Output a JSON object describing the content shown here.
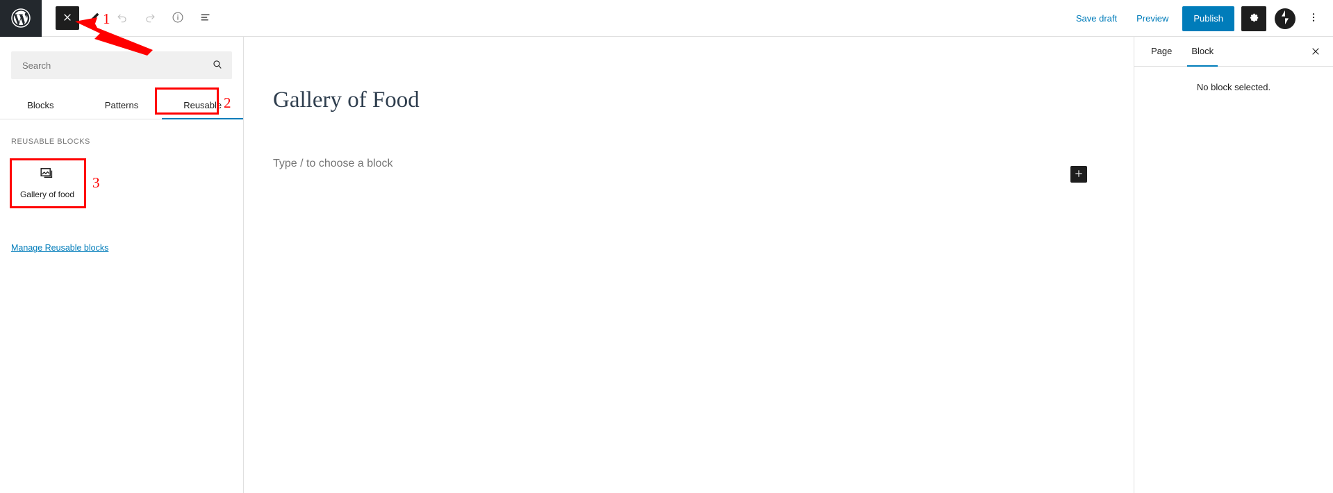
{
  "app": {
    "name": "WordPress Block Editor",
    "logo_icon": "wordpress-logo-icon"
  },
  "header": {
    "close_button": {
      "label": "Close",
      "icon": "close-icon"
    },
    "tools": [
      {
        "name": "edit-pencil",
        "icon": "pencil-icon",
        "label": "Edit",
        "disabled": false
      },
      {
        "name": "undo",
        "icon": "undo-arrow-icon",
        "label": "Undo",
        "disabled": true
      },
      {
        "name": "redo",
        "icon": "redo-arrow-icon",
        "label": "Redo",
        "disabled": true
      },
      {
        "name": "details",
        "icon": "info-circle-icon",
        "label": "Details",
        "disabled": false
      },
      {
        "name": "list-view",
        "icon": "list-view-icon",
        "label": "List view",
        "disabled": false
      }
    ],
    "save_draft_label": "Save draft",
    "preview_label": "Preview",
    "publish_label": "Publish",
    "settings_icon": "gear-icon",
    "jetpack_icon": "jetpack-icon",
    "more_options_icon": "kebab-menu-icon"
  },
  "inserter": {
    "search": {
      "placeholder": "Search",
      "value": "",
      "icon": "search-icon"
    },
    "tabs": [
      {
        "label": "Blocks",
        "active": false
      },
      {
        "label": "Patterns",
        "active": false
      },
      {
        "label": "Reusable",
        "active": true
      }
    ],
    "section_title": "REUSABLE BLOCKS",
    "blocks": [
      {
        "label": "Gallery of food",
        "icon": "gallery-icon"
      }
    ],
    "manage_link_label": "Manage Reusable blocks"
  },
  "editor": {
    "post_title": "Gallery of Food",
    "paragraph_placeholder": "Type / to choose a block",
    "inserter_icon": "plus-icon"
  },
  "settings_sidebar": {
    "tabs": [
      {
        "label": "Page",
        "active": false
      },
      {
        "label": "Block",
        "active": true
      }
    ],
    "close_icon": "close-icon",
    "empty_message": "No block selected."
  },
  "annotations": {
    "color": "#ff0000",
    "markers": [
      {
        "number": "1",
        "target": "close-editor-button",
        "has_arrow": true
      },
      {
        "number": "2",
        "target": "reusable-tab",
        "has_arrow": false
      },
      {
        "number": "3",
        "target": "reusable-block-gallery-of-food",
        "has_arrow": false
      }
    ]
  }
}
